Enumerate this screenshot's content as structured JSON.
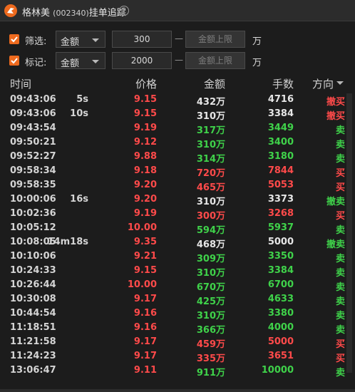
{
  "window": {
    "name": "格林美",
    "code": "(002340)",
    "tool": "挂单追踪",
    "help": "?"
  },
  "filters": [
    {
      "label": "筛选:",
      "checked": true,
      "select": "金额",
      "value": "300",
      "placeholder": "金额上限",
      "separator": "—",
      "unit": "万"
    },
    {
      "label": "标记:",
      "checked": true,
      "select": "金额",
      "value": "2000",
      "placeholder": "金额上限",
      "separator": "—",
      "unit": "万"
    }
  ],
  "columns": [
    "时间",
    "价格",
    "金额",
    "手数",
    "方向"
  ],
  "colors": {
    "up": "#ff4a4a",
    "down": "#3fd24a",
    "neutral": "#e6e6e6",
    "accent": "#ee6a1e"
  },
  "rows": [
    {
      "time": "09:43:06",
      "gap": "5s",
      "price": "9.15",
      "amount": "432万",
      "volume": "4716",
      "direction": "撤买",
      "amt_color": "white",
      "vol_color": "white",
      "dir_color": "red"
    },
    {
      "time": "09:43:06",
      "gap": "10s",
      "price": "9.15",
      "amount": "310万",
      "volume": "3384",
      "direction": "撤买",
      "amt_color": "white",
      "vol_color": "white",
      "dir_color": "red"
    },
    {
      "time": "09:43:54",
      "gap": "",
      "price": "9.19",
      "amount": "317万",
      "volume": "3449",
      "direction": "卖",
      "amt_color": "green",
      "vol_color": "green",
      "dir_color": "green"
    },
    {
      "time": "09:50:21",
      "gap": "",
      "price": "9.12",
      "amount": "310万",
      "volume": "3400",
      "direction": "卖",
      "amt_color": "green",
      "vol_color": "green",
      "dir_color": "green"
    },
    {
      "time": "09:52:27",
      "gap": "",
      "price": "9.88",
      "amount": "314万",
      "volume": "3180",
      "direction": "卖",
      "amt_color": "green",
      "vol_color": "green",
      "dir_color": "green"
    },
    {
      "time": "09:58:34",
      "gap": "",
      "price": "9.18",
      "amount": "720万",
      "volume": "7844",
      "direction": "买",
      "amt_color": "red",
      "vol_color": "red",
      "dir_color": "red"
    },
    {
      "time": "09:58:35",
      "gap": "",
      "price": "9.20",
      "amount": "465万",
      "volume": "5053",
      "direction": "买",
      "amt_color": "red",
      "vol_color": "red",
      "dir_color": "red"
    },
    {
      "time": "10:00:06",
      "gap": "16s",
      "price": "9.20",
      "amount": "310万",
      "volume": "3373",
      "direction": "撤卖",
      "amt_color": "white",
      "vol_color": "white",
      "dir_color": "green"
    },
    {
      "time": "10:02:36",
      "gap": "",
      "price": "9.19",
      "amount": "300万",
      "volume": "3268",
      "direction": "买",
      "amt_color": "red",
      "vol_color": "red",
      "dir_color": "red"
    },
    {
      "time": "10:05:12",
      "gap": "",
      "price": "10.00",
      "amount": "594万",
      "volume": "5937",
      "direction": "卖",
      "amt_color": "green",
      "vol_color": "green",
      "dir_color": "green"
    },
    {
      "time": "10:08:05",
      "gap": "14m18s",
      "price": "9.35",
      "amount": "468万",
      "volume": "5000",
      "direction": "撤卖",
      "amt_color": "white",
      "vol_color": "white",
      "dir_color": "green"
    },
    {
      "time": "10:10:06",
      "gap": "",
      "price": "9.21",
      "amount": "309万",
      "volume": "3350",
      "direction": "卖",
      "amt_color": "green",
      "vol_color": "green",
      "dir_color": "green"
    },
    {
      "time": "10:24:33",
      "gap": "",
      "price": "9.15",
      "amount": "310万",
      "volume": "3384",
      "direction": "卖",
      "amt_color": "green",
      "vol_color": "green",
      "dir_color": "green"
    },
    {
      "time": "10:26:44",
      "gap": "",
      "price": "10.00",
      "amount": "670万",
      "volume": "6700",
      "direction": "卖",
      "amt_color": "green",
      "vol_color": "green",
      "dir_color": "green"
    },
    {
      "time": "10:30:08",
      "gap": "",
      "price": "9.17",
      "amount": "425万",
      "volume": "4633",
      "direction": "卖",
      "amt_color": "green",
      "vol_color": "green",
      "dir_color": "green"
    },
    {
      "time": "10:44:54",
      "gap": "",
      "price": "9.16",
      "amount": "310万",
      "volume": "3380",
      "direction": "卖",
      "amt_color": "green",
      "vol_color": "green",
      "dir_color": "green"
    },
    {
      "time": "11:18:51",
      "gap": "",
      "price": "9.16",
      "amount": "366万",
      "volume": "4000",
      "direction": "卖",
      "amt_color": "green",
      "vol_color": "green",
      "dir_color": "green"
    },
    {
      "time": "11:21:58",
      "gap": "",
      "price": "9.17",
      "amount": "459万",
      "volume": "5000",
      "direction": "买",
      "amt_color": "red",
      "vol_color": "red",
      "dir_color": "red"
    },
    {
      "time": "11:24:23",
      "gap": "",
      "price": "9.17",
      "amount": "335万",
      "volume": "3651",
      "direction": "买",
      "amt_color": "red",
      "vol_color": "red",
      "dir_color": "red"
    },
    {
      "time": "13:06:47",
      "gap": "",
      "price": "9.11",
      "amount": "911万",
      "volume": "10000",
      "direction": "卖",
      "amt_color": "green",
      "vol_color": "green",
      "dir_color": "green"
    }
  ]
}
